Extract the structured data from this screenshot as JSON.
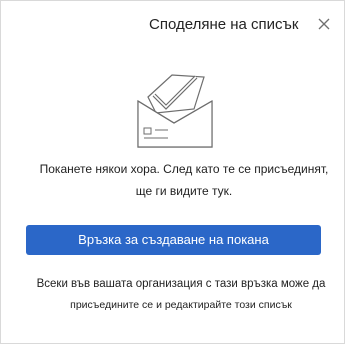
{
  "dialog": {
    "title": "Споделяне на списък",
    "close_icon": "close-icon",
    "illustration_icon": "envelope-checkmark-icon",
    "message": "Поканете някои хора. След като те се присъединят, ще ги видите тук.",
    "primary_button_label": "Връзка за създаване на покана",
    "footer_line1": "Всеки във вашата организация с тази връзка може да",
    "footer_line2": "присъедините се и редактирайте този списък",
    "accent_color": "#2b67c8"
  }
}
